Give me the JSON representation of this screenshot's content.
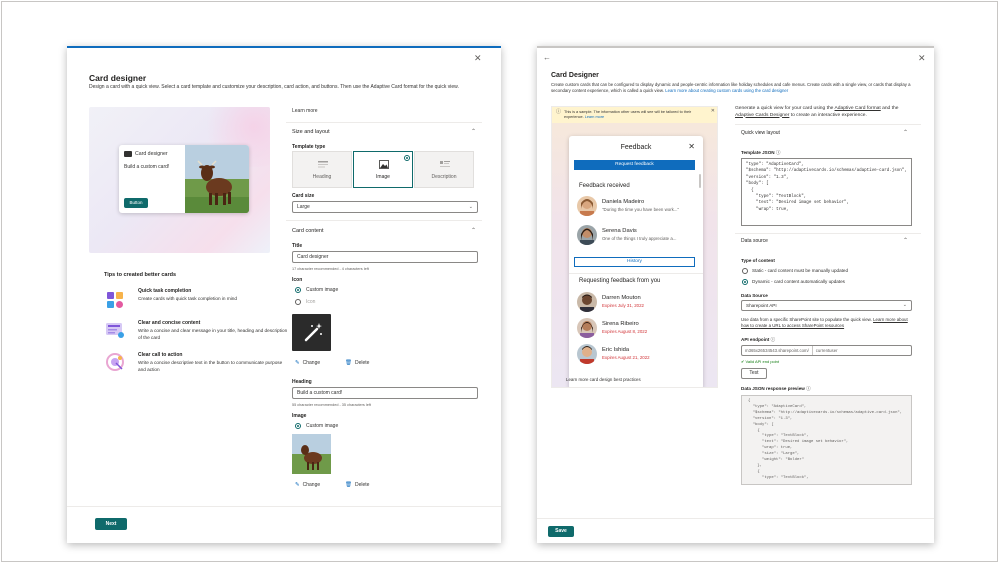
{
  "left": {
    "title": "Card designer",
    "description": "Design a card with a quick view. Select a card template and customize your description, card action, and buttons. Then use the Adaptive Card format for the quick view.",
    "preview": {
      "card_title": "Card designer",
      "card_subtitle": "Build a custom card!",
      "button_label": "Button"
    },
    "tips": {
      "title": "Tips to created better cards",
      "items": [
        {
          "heading": "Quick task completion",
          "text": "Create cards with quick task completion in mind"
        },
        {
          "heading": "Clear and concise content",
          "text": "Write a concise and clear message in your title, heading and description of the card"
        },
        {
          "heading": "Clear call to action",
          "text": "Write a concise descriptive text in the button to communicate purpose and action"
        }
      ]
    },
    "learn_more": "Learn more",
    "size_layout": {
      "section": "Size and layout",
      "template_type_label": "Template type",
      "templates": [
        "Heading",
        "Image",
        "Description"
      ],
      "selected_template": "Image",
      "card_size_label": "Card size",
      "card_size_value": "Large"
    },
    "card_content": {
      "section": "Card content",
      "title_label": "Title",
      "title_value": "Card designer",
      "title_hint": "17 character recommended - 4 characters left",
      "icon_label": "Icon",
      "icon_options": [
        "Custom image",
        "Icon"
      ],
      "change_label": "Change",
      "delete_label": "Delete",
      "heading_label": "Heading",
      "heading_value": "Build a custom card!",
      "heading_hint": "55 character recommended - 35 characters left",
      "image_label": "Image",
      "image_option": "Custom image"
    },
    "next_label": "Next"
  },
  "right": {
    "title": "Card Designer",
    "description": "Create custom cards that can be configured to display dynamic and people-centric information like holiday schedules and cafe menus. Create cards with a single view, or cards that display a secondary content experience, which is called a quick view.",
    "description_link": "Learn more about creating custom cards using the card designer",
    "sample_note": "This is a sample. The information other users will see will be tailored to their experience.",
    "sample_note_link": "Learn more",
    "feedback": {
      "title": "Feedback",
      "request_button": "Request feedback",
      "received_header": "Feedback received",
      "received": [
        {
          "name": "Daniela Madeiro",
          "quote": "\"During the time you have been work...\""
        },
        {
          "name": "Serena Davis",
          "quote": "One of the things I truly appreciate a..."
        }
      ],
      "history_button": "History",
      "requesting_header": "Requesting feedback from you",
      "requesting": [
        {
          "name": "Darren Mouton",
          "expires": "Expires July 31, 2022"
        },
        {
          "name": "Sirena Ribeiro",
          "expires": "Expires August 8, 2022"
        },
        {
          "name": "Eric Ishida",
          "expires": "Expires August 21, 2022"
        }
      ]
    },
    "best_practices_link": "Learn more card design best practices",
    "intro_1": "Generate a quick view for your card using the",
    "intro_link_1": "Adaptive Card format",
    "intro_2": "and the",
    "intro_link_2": "Adaptive Cards Designer",
    "intro_3": "to create an interactive experience.",
    "quick_view_section": "Quick view layout",
    "template_json_label": "Template JSON",
    "template_json": "\"type\": \"AdaptiveCard\",\n\"$schema\": \"http://adaptivecards.io/schemas/adaptive-card.json\",\n\"version\": \"1.3\",\n\"body\": [\n  {\n    \"type\": \"TextBlock\",\n    \"text\": \"Desired image set behavior\",\n    \"wrap\": true,",
    "data_source_section": "Data source",
    "type_of_content_label": "Type of content",
    "content_options": [
      "Static - card content must be manually updated",
      "Dynamic - card content automatically updates"
    ],
    "data_source_label": "Data Source",
    "data_source_value": "Sharepoint API",
    "data_source_help": "Use data from a specific SharePoint site to populate the quick view.",
    "data_source_help_link": "Learn more about how to create a URL to access SharePoint resources",
    "api_label": "API endpoint",
    "api_prefix": "m365x26534543.sharepoint.com/",
    "api_value": "currentuser",
    "api_valid": "Valid API end point",
    "test_label": "Test",
    "response_label": "Data JSON response preview",
    "response_json": "{\n  \"type\": \"AdaptiveCard\",\n  \"$schema\": \"http://adaptivecards.io/schemas/adaptive-card.json\",\n  \"version\": \"1.3\",\n  \"body\": [\n    {\n      \"type\": \"TextBlock\",\n      \"text\": \"Desired image set behavior\",\n      \"wrap\": true,\n      \"size\": \"Large\",\n      \"weight\": \"Bolder\"\n    },\n    {\n      \"type\": \"TextBlock\",",
    "save_label": "Save"
  },
  "colors": {
    "teal": "#0f6a6b",
    "blue": "#0f6cbd",
    "red": "#d13438",
    "green": "#107c10"
  }
}
